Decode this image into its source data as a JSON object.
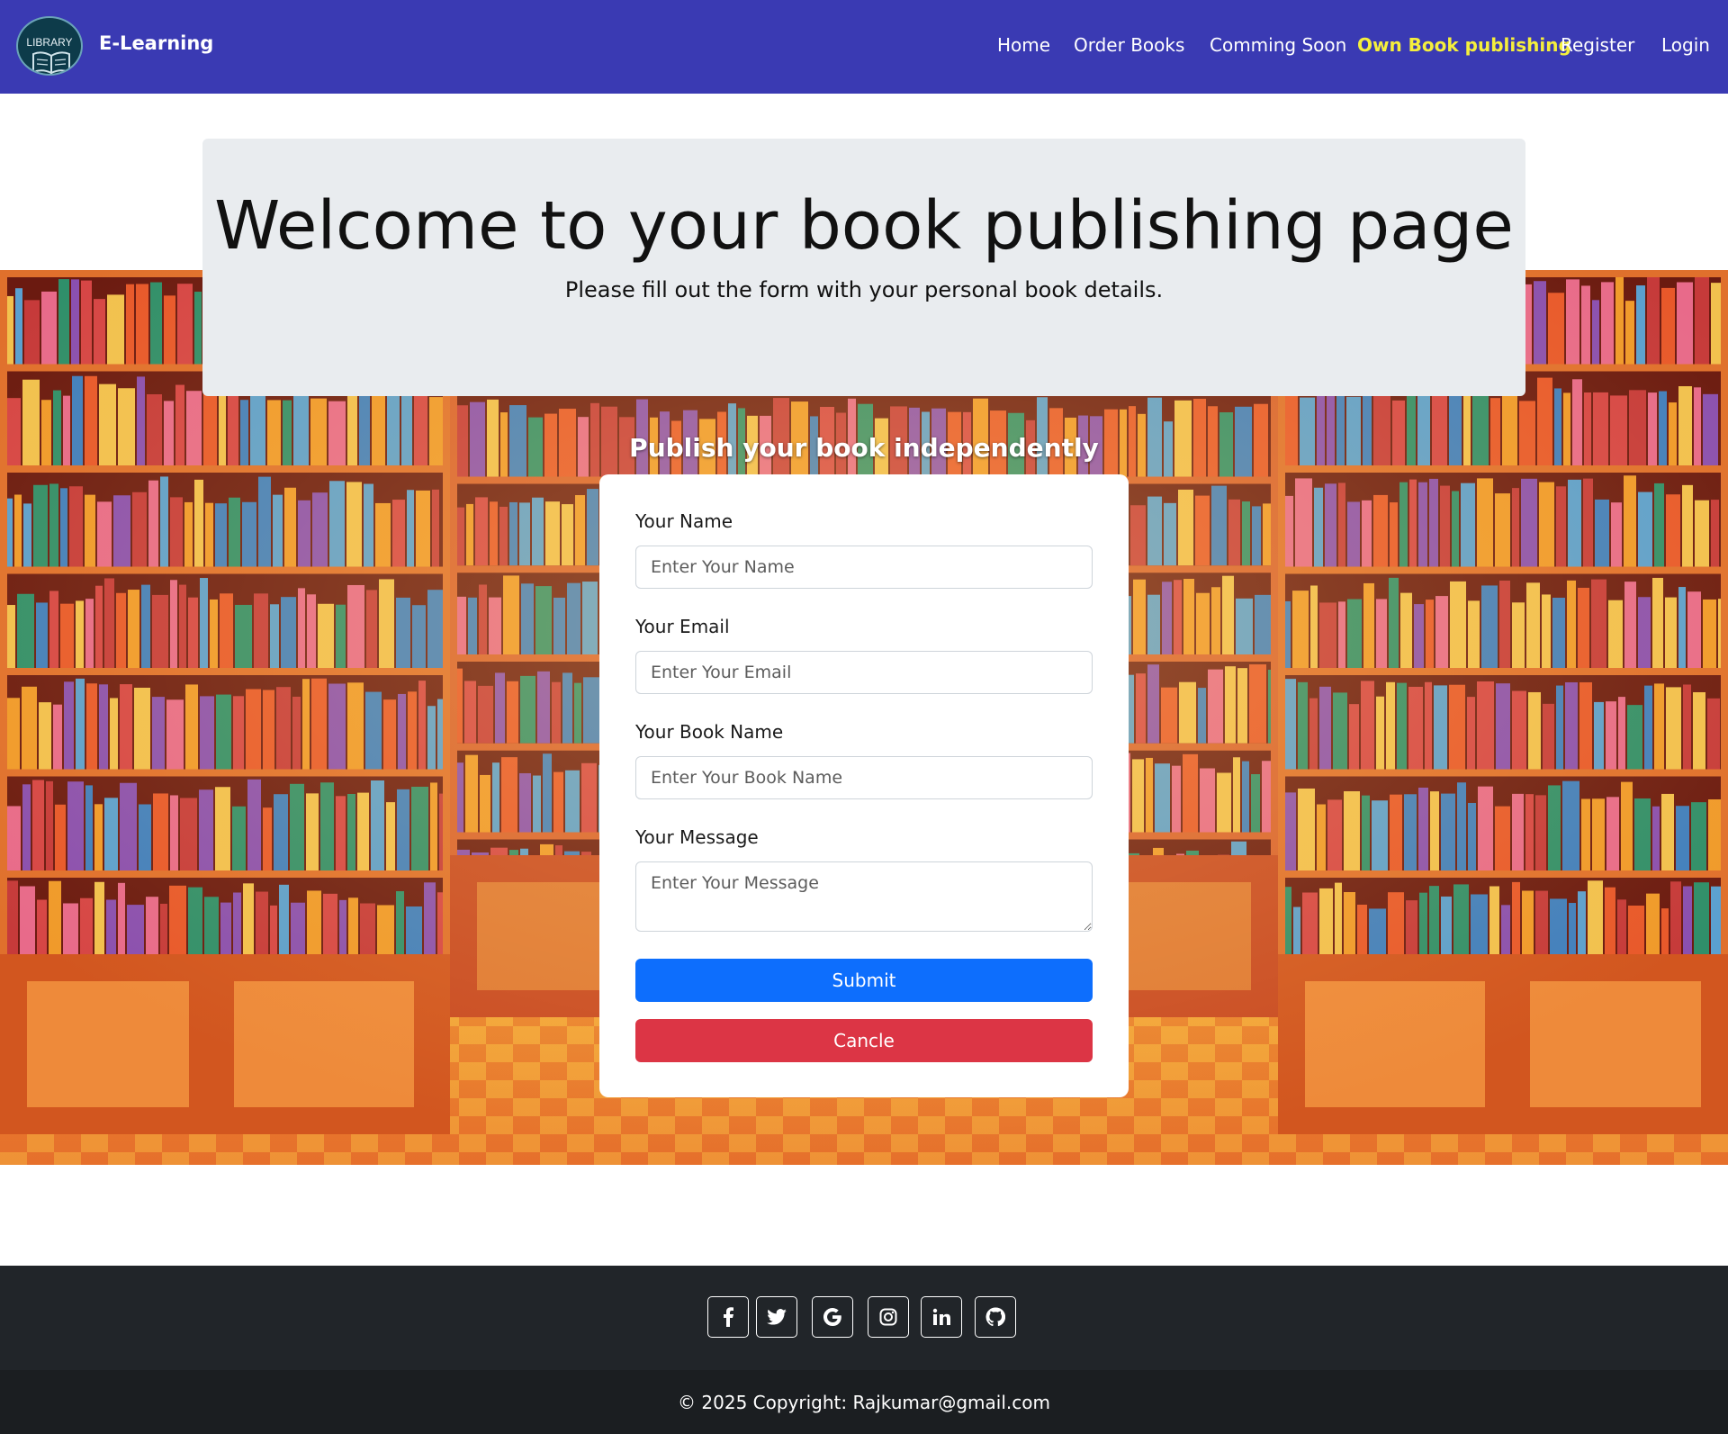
{
  "nav": {
    "logo_text": "LIBRARY",
    "brand": "E-Learning",
    "links": [
      "Home",
      "Order Books",
      "Comming Soon",
      "Own Book publishing",
      "Register",
      "Login"
    ],
    "active_link": "Own Book publishing",
    "active_color": "#f5ef3c",
    "bg_color": "#3a3ab3"
  },
  "jumbotron": {
    "title": "Welcome to your book publishing page",
    "subtitle": "Please fill out the form with your personal book details."
  },
  "form": {
    "heading": "Publish your book independently",
    "name_label": "Your Name",
    "name_placeholder": "Enter Your Name",
    "email_label": "Your Email",
    "email_placeholder": "Enter Your Email",
    "book_label": "Your Book Name",
    "book_placeholder": "Enter Your Book Name",
    "message_label": "Your Message",
    "message_placeholder": "Enter Your Message",
    "submit_label": "Submit",
    "cancel_label": "Cancle",
    "submit_color": "#0d6efd",
    "cancel_color": "#dc3545"
  },
  "footer": {
    "social_icons": [
      "facebook-icon",
      "twitter-icon",
      "google-icon",
      "instagram-icon",
      "linkedin-icon",
      "github-icon"
    ],
    "copyright": "© 2025 Copyright: Rajkumar@gmail.com"
  }
}
